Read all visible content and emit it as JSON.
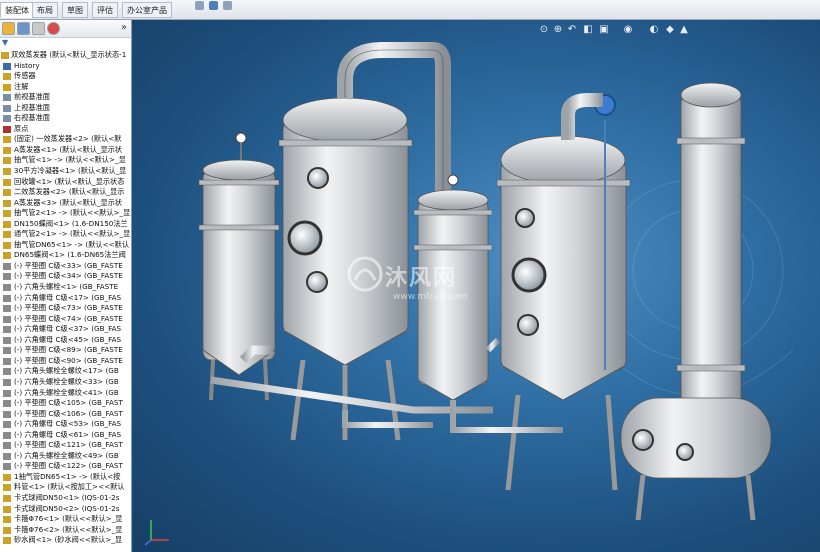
{
  "tabs": [
    {
      "label": "装配体",
      "active": true
    },
    {
      "label": "布局",
      "active": false
    },
    {
      "label": "草图",
      "active": false
    },
    {
      "label": "评估",
      "active": false
    },
    {
      "label": "办公室产品",
      "active": false
    }
  ],
  "tree": {
    "root": "双效蒸发器 (默认<默认_显示状态-1",
    "items": [
      {
        "label": "History",
        "icon": "history-icon",
        "color": "#3a6ea5"
      },
      {
        "label": "传感器",
        "icon": "sensor-icon",
        "color": "#c9a227"
      },
      {
        "label": "注解",
        "icon": "annotation-icon",
        "color": "#d4a017"
      },
      {
        "label": "前视基准面",
        "icon": "plane-icon",
        "color": "#7a8fa6"
      },
      {
        "label": "上视基准面",
        "icon": "plane-icon",
        "color": "#7a8fa6"
      },
      {
        "label": "右视基准面",
        "icon": "plane-icon",
        "color": "#7a8fa6"
      },
      {
        "label": "原点",
        "icon": "origin-icon",
        "color": "#b03030"
      },
      {
        "label": "(固定) 一效蒸发器<2> (默认<默",
        "icon": "part-icon",
        "color": "#c9a227"
      },
      {
        "label": "A蒸发器<1> (默认<默认_显示状",
        "icon": "part-icon",
        "color": "#c9a227"
      },
      {
        "label": "抽气管<1> -> (默认<<默认>_显",
        "icon": "part-icon",
        "color": "#c9a227"
      },
      {
        "label": "30平方冷凝器<1> (默认<默认_显",
        "icon": "part-icon",
        "color": "#c9a227"
      },
      {
        "label": "回收罐<1> (默认<默认_显示状态",
        "icon": "part-icon",
        "color": "#c9a227"
      },
      {
        "label": "二效蒸发器<2> (默认<默认_显示",
        "icon": "part-icon",
        "color": "#c9a227"
      },
      {
        "label": "A蒸发器<3> (默认<默认_显示状",
        "icon": "part-icon",
        "color": "#c9a227"
      },
      {
        "label": "抽气管2<1> -> (默认<<默认>_显",
        "icon": "part-icon",
        "color": "#c9a227"
      },
      {
        "label": "DN150蝶阀<1> (1.6-DN150法兰",
        "icon": "part-icon",
        "color": "#c9a227"
      },
      {
        "label": "通气管2<1> -> (默认<<默认>_显",
        "icon": "part-icon",
        "color": "#c9a227"
      },
      {
        "label": "抽气管DN65<1> -> (默认<<默认",
        "icon": "part-icon",
        "color": "#c9a227"
      },
      {
        "label": "DN65蝶阀<1> (1.6-DN65法兰阀",
        "icon": "part-icon",
        "color": "#c9a227"
      },
      {
        "label": "(-) 平垫圈 C级<33> (GB_FASTE",
        "icon": "fastener-icon",
        "color": "#8a8a8a"
      },
      {
        "label": "(-) 平垫圈 C级<34> (GB_FASTE",
        "icon": "fastener-icon",
        "color": "#8a8a8a"
      },
      {
        "label": "(-) 六角头螺栓<1> (GB_FASTE",
        "icon": "fastener-icon",
        "color": "#8a8a8a"
      },
      {
        "label": "(-) 六角螺母 C级<17> (GB_FAS",
        "icon": "fastener-icon",
        "color": "#8a8a8a"
      },
      {
        "label": "(-) 平垫圈 C级<73> (GB_FASTE",
        "icon": "fastener-icon",
        "color": "#8a8a8a"
      },
      {
        "label": "(-) 平垫圈 C级<74> (GB_FASTE",
        "icon": "fastener-icon",
        "color": "#8a8a8a"
      },
      {
        "label": "(-) 六角螺母 C级<37> (GB_FAS",
        "icon": "fastener-icon",
        "color": "#8a8a8a"
      },
      {
        "label": "(-) 六角螺母 C级<45> (GB_FAS",
        "icon": "fastener-icon",
        "color": "#8a8a8a"
      },
      {
        "label": "(-) 平垫圈 C级<89> (GB_FASTE",
        "icon": "fastener-icon",
        "color": "#8a8a8a"
      },
      {
        "label": "(-) 平垫圈 C级<90> (GB_FASTE",
        "icon": "fastener-icon",
        "color": "#8a8a8a"
      },
      {
        "label": "(-) 六角头螺栓全螺纹<17> (GB",
        "icon": "fastener-icon",
        "color": "#8a8a8a"
      },
      {
        "label": "(-) 六角头螺栓全螺纹<33> (GB",
        "icon": "fastener-icon",
        "color": "#8a8a8a"
      },
      {
        "label": "(-) 六角头螺栓全螺纹<41> (GB",
        "icon": "fastener-icon",
        "color": "#8a8a8a"
      },
      {
        "label": "(-) 平垫圈 C级<105> (GB_FAST",
        "icon": "fastener-icon",
        "color": "#8a8a8a"
      },
      {
        "label": "(-) 平垫圈 C级<106> (GB_FAST",
        "icon": "fastener-icon",
        "color": "#8a8a8a"
      },
      {
        "label": "(-) 六角螺母 C级<53> (GB_FAS",
        "icon": "fastener-icon",
        "color": "#8a8a8a"
      },
      {
        "label": "(-) 六角螺母 C级<61> (GB_FAS",
        "icon": "fastener-icon",
        "color": "#8a8a8a"
      },
      {
        "label": "(-) 平垫圈 C级<121> (GB_FAST",
        "icon": "fastener-icon",
        "color": "#8a8a8a"
      },
      {
        "label": "(-) 六角头螺栓全螺纹<49> (GB",
        "icon": "fastener-icon",
        "color": "#8a8a8a"
      },
      {
        "label": "(-) 平垫圈 C级<122> (GB_FAST",
        "icon": "fastener-icon",
        "color": "#8a8a8a"
      },
      {
        "label": "1抽气管DN65<1> -> (默认<按",
        "icon": "part-icon",
        "color": "#c9a227"
      },
      {
        "label": "料管<1> (默认<按加工><<默认",
        "icon": "part-icon",
        "color": "#c9a227"
      },
      {
        "label": "卡式球阀DN50<1> (IQS-01-2s",
        "icon": "part-icon",
        "color": "#c9a227"
      },
      {
        "label": "卡式球阀DN50<2> (IQS-01-2s",
        "icon": "part-icon",
        "color": "#c9a227"
      },
      {
        "label": "卡箍Φ76<1> (默认<<默认>_显",
        "icon": "part-icon",
        "color": "#c9a227"
      },
      {
        "label": "卡箍Φ76<2> (默认<<默认>_显",
        "icon": "part-icon",
        "color": "#c9a227"
      },
      {
        "label": "砂水阀<1> (砂水阀<<默认>_显",
        "icon": "part-icon",
        "color": "#c9a227"
      }
    ]
  },
  "watermark": {
    "text": "沐风网",
    "url": "www.mfcad.com"
  },
  "viewport_icons": [
    "zoom-fit-icon",
    "zoom-area-icon",
    "previous-view-icon",
    "section-view-icon",
    "view-orientation-icon",
    "display-style-icon",
    "hide-show-icon",
    "edit-appearance-icon",
    "scene-icon"
  ],
  "colors": {
    "accent": "#3a7bd5",
    "viewport_bg": "#2f6ea3",
    "steel": "#d6d9dc"
  }
}
